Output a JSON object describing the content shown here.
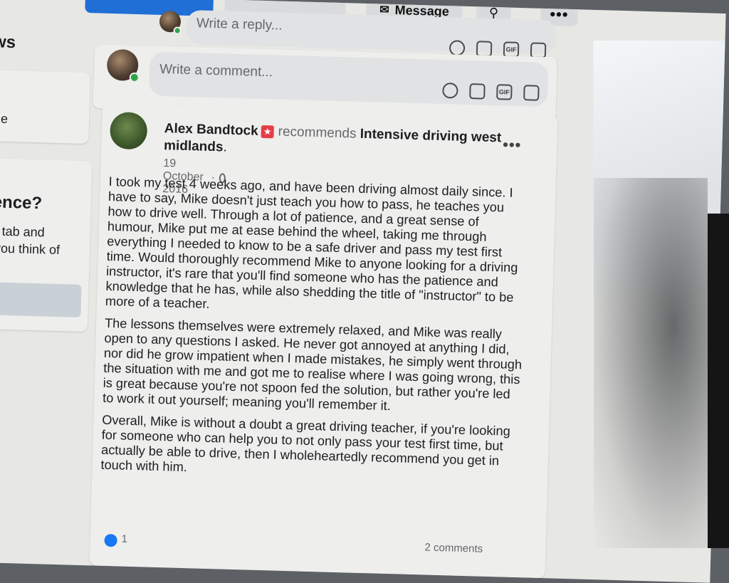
{
  "topbar": {
    "message_label": "Message",
    "more_label": "•••"
  },
  "left_panel": {
    "heading_partial": "ws",
    "card1_text": "ble",
    "card2_title": "ence?",
    "card2_line1": "s tab and",
    "card2_line2": "you think of"
  },
  "reply": {
    "placeholder": "Write a reply..."
  },
  "comment": {
    "placeholder": "Write a comment..."
  },
  "post": {
    "author": "Alex Bandtock",
    "verb": "recommends",
    "page_name_line1": "Intensive driving west",
    "page_name_line2": "midlands",
    "date": "19 October 2016",
    "date_separator": "·",
    "more_label": "•••",
    "paragraphs": [
      "I took my test 4 weeks ago, and have been driving almost daily since. I have to say, Mike doesn't just teach you how to pass, he teaches you how to drive well. Through a lot of patience, and a great sense of humour, Mike put me at ease behind the wheel, taking me through everything I needed to know to be a safe driver and pass my test first time. Would thoroughly recommend Mike to anyone looking for a driving instructor, it's rare that you'll find someone who has the patience and knowledge that he has, while also shedding the title of \"instructor\" to be more of a teacher.",
      "The lessons themselves were extremely relaxed, and Mike was really open to any questions I asked. He never got annoyed at anything I did, nor did he grow impatient when I made mistakes, he simply went through the situation with me and got me to realise where I was going wrong, this is great because you're not spoon fed the solution, but rather you're led to work it out yourself; meaning you'll remember it.",
      "Overall, Mike is without a doubt a great driving teacher, if you're looking for someone who can help you to not only pass your test first time, but actually be able to drive, then I wholeheartedly recommend you get in touch with him."
    ],
    "reaction_count": "1",
    "comments_count": "2 comments"
  },
  "colors": {
    "accent": "#1877f2",
    "recommend_star": "#e53e47",
    "online": "#31a24c"
  }
}
